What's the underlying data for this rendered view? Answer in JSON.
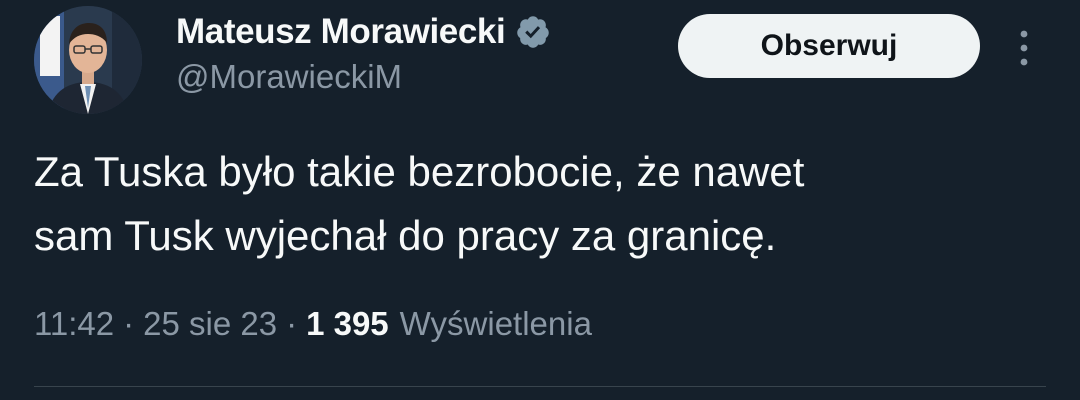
{
  "author": {
    "display_name": "Mateusz Morawiecki",
    "handle": "@MorawieckiM",
    "verified_icon": "verified-badge-icon"
  },
  "actions": {
    "follow_label": "Obserwuj",
    "more_icon": "more-vertical-icon"
  },
  "tweet": {
    "text_lines": [
      "Za Tuska było takie bezrobocie, że nawet",
      "sam Tusk wyjechał do pracy za granicę."
    ]
  },
  "meta": {
    "time": "11:42",
    "separator": "·",
    "date": "25 sie 23",
    "views_count": "1 395",
    "views_label": "Wyświetlenia"
  },
  "colors": {
    "background": "#15202b",
    "primary_text": "#f7f9f9",
    "secondary_text": "#8b98a5",
    "button_bg": "#eff3f4",
    "button_text": "#0f1419",
    "badge": "#829aab"
  }
}
